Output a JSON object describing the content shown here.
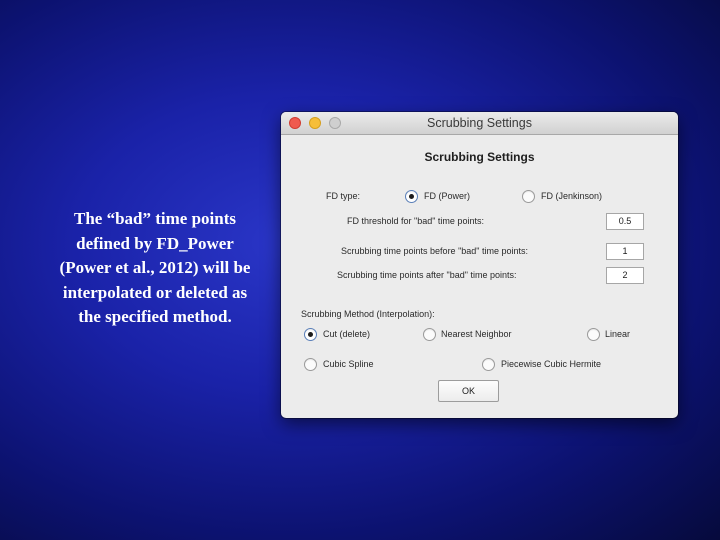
{
  "caption": {
    "lines": [
      "The “bad” time points",
      "defined by FD_Power",
      "(Power et al., 2012) will be",
      "interpolated or deleted as",
      "the specified method."
    ]
  },
  "window": {
    "title": "Scrubbing Settings",
    "heading": "Scrubbing Settings",
    "fd_type": {
      "label": "FD type:",
      "options": [
        {
          "label": "FD (Power)",
          "selected": true
        },
        {
          "label": "FD (Jenkinson)",
          "selected": false
        }
      ]
    },
    "threshold": {
      "label": "FD threshold for \"bad\" time points:",
      "value": "0.5"
    },
    "before": {
      "label": "Scrubbing time points before \"bad\" time points:",
      "value": "1"
    },
    "after": {
      "label": "Scrubbing time points after \"bad\" time points:",
      "value": "2"
    },
    "method": {
      "label": "Scrubbing Method (Interpolation):",
      "options": [
        {
          "label": "Cut (delete)",
          "selected": true
        },
        {
          "label": "Nearest Neighbor",
          "selected": false
        },
        {
          "label": "Linear",
          "selected": false
        },
        {
          "label": "Cubic Spline",
          "selected": false
        },
        {
          "label": "Piecewise Cubic Hermite",
          "selected": false
        }
      ]
    },
    "ok_label": "OK"
  }
}
